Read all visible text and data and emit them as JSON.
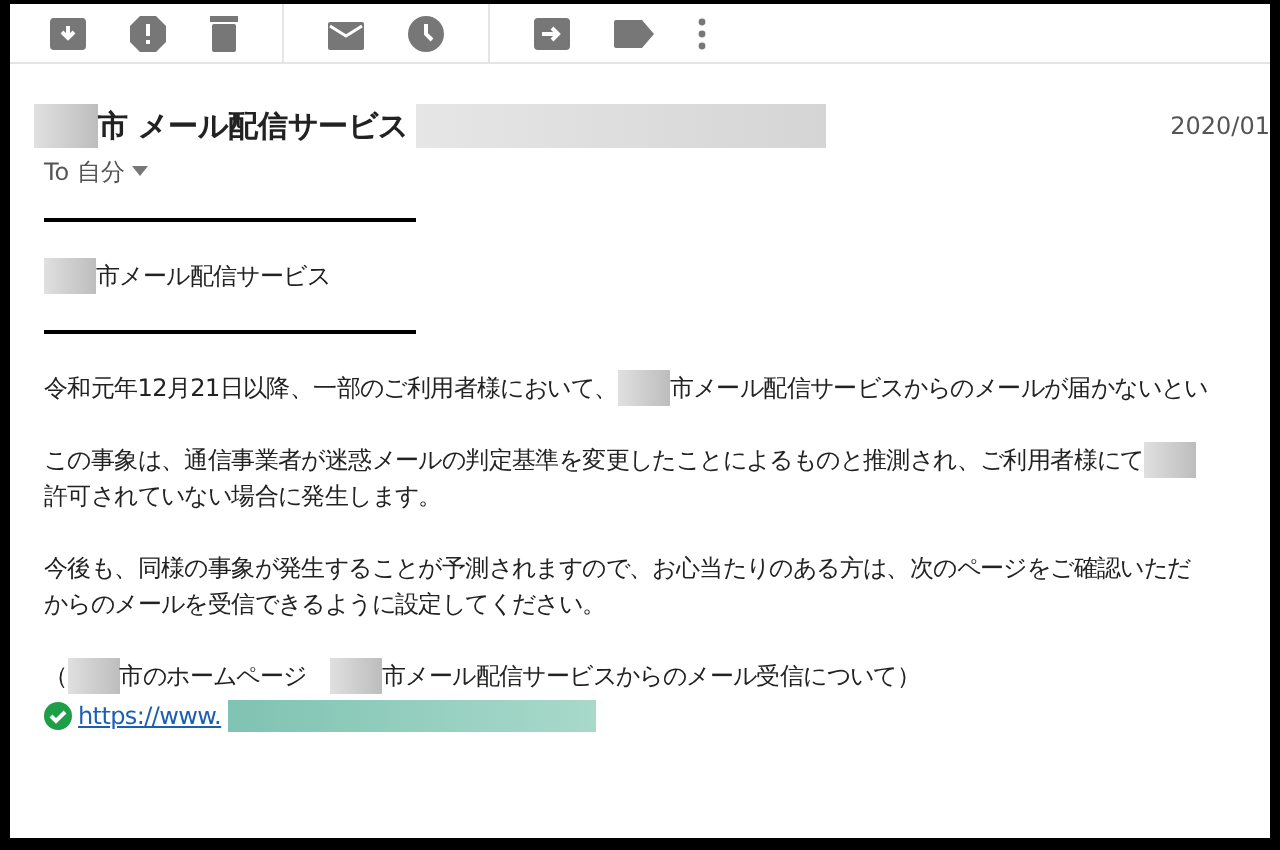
{
  "toolbar": {
    "buttons": [
      {
        "kind": "archive"
      },
      {
        "kind": "spam"
      },
      {
        "kind": "trash"
      },
      {
        "kind": "divider"
      },
      {
        "kind": "mail"
      },
      {
        "kind": "clock"
      },
      {
        "kind": "divider"
      },
      {
        "kind": "move"
      },
      {
        "kind": "label"
      },
      {
        "kind": "more"
      }
    ]
  },
  "email": {
    "subject": [
      {
        "kind": "redacted"
      },
      {
        "kind": "text",
        "text": "市 メール配信サービス"
      },
      {
        "kind": "redacted_long"
      }
    ],
    "date": "2020/01",
    "recipient": "To 自分",
    "body": [
      {
        "kind": "rule"
      },
      {
        "kind": "line",
        "segments": [
          {
            "kind": "redacted"
          },
          {
            "kind": "text",
            "text": "市メール配信サービス"
          }
        ]
      },
      {
        "kind": "rule"
      },
      {
        "kind": "paragraph",
        "lines": [
          [
            {
              "kind": "text",
              "text": "令和元年12月21日以降、一部のご利用者様において、"
            },
            {
              "kind": "redacted"
            },
            {
              "kind": "text",
              "text": "市メール配信サービスからのメールが届かないとい"
            }
          ]
        ]
      },
      {
        "kind": "paragraph",
        "lines": [
          [
            {
              "kind": "text",
              "text": "この事象は、通信事業者が迷惑メールの判定基準を変更したことによるものと推測され、ご利用者様にて"
            },
            {
              "kind": "redacted"
            }
          ],
          [
            {
              "kind": "text",
              "text": "許可されていない場合に発生します。"
            }
          ]
        ]
      },
      {
        "kind": "paragraph",
        "lines": [
          [
            {
              "kind": "text",
              "text": "今後も、同様の事象が発生することが予測されますので、お心当たりのある方は、次のページをご確認いただ"
            }
          ],
          [
            {
              "kind": "text",
              "text": "からのメールを受信できるように設定してください。"
            }
          ]
        ]
      },
      {
        "kind": "line",
        "segments": [
          {
            "kind": "text",
            "text": "（"
          },
          {
            "kind": "redacted"
          },
          {
            "kind": "text",
            "text": "市のホームページ　"
          },
          {
            "kind": "redacted"
          },
          {
            "kind": "text",
            "text": "市メール配信サービスからのメール受信について）"
          }
        ]
      },
      {
        "kind": "link",
        "text": "https://www."
      }
    ]
  }
}
